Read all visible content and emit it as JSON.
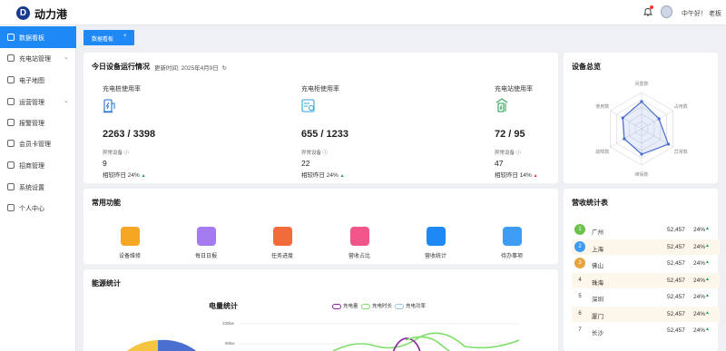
{
  "app": {
    "title": "动力港",
    "logo_letter": "D"
  },
  "header": {
    "greeting": "中午好！ 老板"
  },
  "sidebar": {
    "items": [
      {
        "label": "数据看板",
        "active": true,
        "has_children": false,
        "icon": "dashboard-icon"
      },
      {
        "label": "充电站管理",
        "active": false,
        "has_children": true,
        "icon": "charging-station-icon"
      },
      {
        "label": "电子地图",
        "active": false,
        "has_children": false,
        "icon": "map-icon"
      },
      {
        "label": "运营管理",
        "active": false,
        "has_children": true,
        "icon": "operations-icon"
      },
      {
        "label": "报警管理",
        "active": false,
        "has_children": false,
        "icon": "alarm-icon"
      },
      {
        "label": "会员卡管理",
        "active": false,
        "has_children": false,
        "icon": "member-card-icon"
      },
      {
        "label": "招商管理",
        "active": false,
        "has_children": false,
        "icon": "investment-icon"
      },
      {
        "label": "系统设置",
        "active": false,
        "has_children": false,
        "icon": "settings-icon"
      },
      {
        "label": "个人中心",
        "active": false,
        "has_children": false,
        "icon": "user-icon"
      }
    ]
  },
  "tabs": [
    {
      "label": "数据看板",
      "close": "×"
    }
  ],
  "today": {
    "title": "今日设备运行情况",
    "update_label": "更新时间: 2025年4月9日",
    "stats": [
      {
        "title": "充电桩使用率",
        "value": "2263 / 3398",
        "sub_label": "异常设备 ⓘ",
        "abnormal": "9",
        "compare": "相较昨日 24%",
        "trend": "▲",
        "trend_dir": "up",
        "icon": "charging-pile-icon"
      },
      {
        "title": "充电柜使用率",
        "value": "655 / 1233",
        "sub_label": "异常设备 ⓘ",
        "abnormal": "22",
        "compare": "相较昨日 24%",
        "trend": "▲",
        "trend_dir": "up",
        "icon": "charging-cabinet-icon"
      },
      {
        "title": "充电站使用率",
        "value": "72 / 95",
        "sub_label": "异常设备 ⓘ",
        "abnormal": "47",
        "compare": "相较昨日 14%",
        "trend": "▲",
        "trend_dir": "down",
        "icon": "charging-station-icon"
      }
    ]
  },
  "overview": {
    "title": "设备总览",
    "radar_labels": [
      "闲置数",
      "占用数",
      "异常数",
      "维保数",
      "故障数",
      "使用数"
    ],
    "radar_values": [
      0.75,
      0.55,
      0.85,
      0.7,
      0.55,
      0.6
    ]
  },
  "functions": {
    "title": "常用功能",
    "items": [
      {
        "label": "设备维修",
        "color": "#f5a623",
        "icon": "wrench-icon"
      },
      {
        "label": "每日日报",
        "color": "#a57bf0",
        "icon": "report-icon"
      },
      {
        "label": "任务进度",
        "color": "#f26b3a",
        "icon": "folder-icon"
      },
      {
        "label": "营收占比",
        "color": "#f0568a",
        "icon": "pie-chart-icon"
      },
      {
        "label": "营收统计",
        "color": "#1e88f5",
        "icon": "money-bag-icon"
      },
      {
        "label": "待办事项",
        "color": "#3e9cf5",
        "icon": "todo-icon"
      }
    ]
  },
  "revenue": {
    "title": "营收统计表",
    "rows": [
      {
        "rank": "1",
        "city": "广州",
        "amount": "52,457",
        "pct": "24%",
        "trend": "▲",
        "badge": "#6cc24a"
      },
      {
        "rank": "2",
        "city": "上海",
        "amount": "52,457",
        "pct": "24%",
        "trend": "▲",
        "badge": "#3e9cf5"
      },
      {
        "rank": "3",
        "city": "佛山",
        "amount": "52,457",
        "pct": "24%",
        "trend": "▲",
        "badge": "#e8a33c"
      },
      {
        "rank": "4",
        "city": "珠海",
        "amount": "52,457",
        "pct": "24%",
        "trend": "▲",
        "badge": ""
      },
      {
        "rank": "5",
        "city": "深圳",
        "amount": "52,457",
        "pct": "24%",
        "trend": "▲",
        "badge": ""
      },
      {
        "rank": "6",
        "city": "厦门",
        "amount": "52,457",
        "pct": "24%",
        "trend": "▲",
        "badge": ""
      },
      {
        "rank": "7",
        "city": "长沙",
        "amount": "52,457",
        "pct": "24%",
        "trend": "▲",
        "badge": ""
      }
    ]
  },
  "energy": {
    "title": "能源统计",
    "chart_title": "电量统计",
    "legend": [
      {
        "label": "充电量",
        "color": "#8a1f9e"
      },
      {
        "label": "充电时长",
        "color": "#7dde6a"
      },
      {
        "label": "充电功率",
        "color": "#8cc8f0"
      }
    ],
    "y_ticks": [
      "100kw",
      "80kw"
    ],
    "donut_colors": [
      "#f5c542",
      "#4a6fd1"
    ]
  }
}
